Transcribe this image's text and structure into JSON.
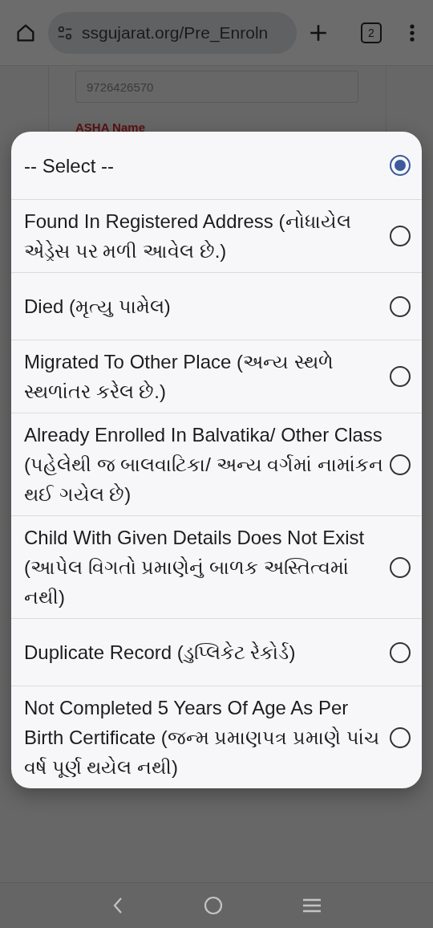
{
  "browser": {
    "url": "ssgujarat.org/Pre_Enroln",
    "tab_count": "2"
  },
  "page": {
    "phone_value": "9726426570",
    "asha_label": "ASHA Name"
  },
  "options": [
    {
      "label": "-- Select --",
      "selected": true
    },
    {
      "label": "Found In Registered Address (નોધાયેલ એડ્રેસ પર મળી આવેલ છે.)",
      "selected": false
    },
    {
      "label": "Died (મૃત્યુ પામેલ)",
      "selected": false
    },
    {
      "label": "Migrated To Other Place (અન્ય સ્થળે સ્થળાંતર કરેલ છે.)",
      "selected": false
    },
    {
      "label": "Already Enrolled In Balvatika/ Other Class (પહેલેથી જ બાલવાટિકા/ અન્ય વર્ગમાં નામાંકન થઈ ગયેલ છે)",
      "selected": false
    },
    {
      "label": "Child With Given Details Does Not Exist (આપેલ વિગતો પ્રમાણેનું બાળક અસ્તિત્વમાં નથી)",
      "selected": false
    },
    {
      "label": "Duplicate Record (ડુપ્લિકેટ રેકોર્ડ)",
      "selected": false
    },
    {
      "label": "Not Completed 5 Years Of Age As Per Birth Certificate (જન્મ પ્રમાણપત્ર પ્રમાણે પાંચ વર્ષ પૂર્ણ થયેલ નથી)",
      "selected": false
    }
  ]
}
